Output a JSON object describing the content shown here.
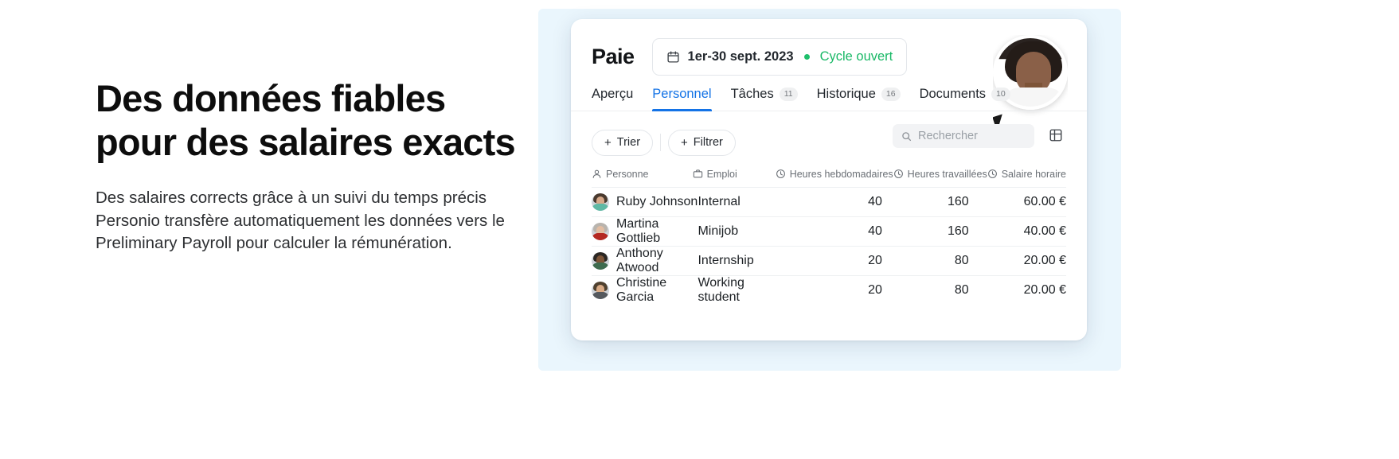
{
  "hero": {
    "headline_line1": "Des données fiables",
    "headline_line2": "pour des salaires exacts",
    "paragraph_line1": "Des salaires corrects grâce à un suivi du temps précis",
    "paragraph_line2": "Personio transfère automatiquement les données vers le",
    "paragraph_line3": "Preliminary Payroll pour calculer la rémunération."
  },
  "app": {
    "brand": "Paie",
    "date_range": "1er-30 sept. 2023",
    "cycle_status": "Cycle ouvert",
    "status_color": "#19b866",
    "accent_color": "#1473e6",
    "tabs": [
      {
        "label": "Aperçu",
        "badge": "",
        "active": false
      },
      {
        "label": "Personnel",
        "badge": "",
        "active": true
      },
      {
        "label": "Tâches",
        "badge": "11",
        "active": false
      },
      {
        "label": "Historique",
        "badge": "16",
        "active": false
      },
      {
        "label": "Documents",
        "badge": "10",
        "active": false
      }
    ],
    "toolbar": {
      "sort_label": "Trier",
      "filter_label": "Filtrer",
      "plus_glyph": "+",
      "search_placeholder": "Rechercher",
      "search_value": ""
    },
    "table": {
      "columns": [
        {
          "label": "Personne",
          "icon": "person-icon"
        },
        {
          "label": "Emploi",
          "icon": "briefcase-icon"
        },
        {
          "label": "Heures hebdomadaires",
          "icon": "clock-icon"
        },
        {
          "label": "Heures travaillées",
          "icon": "clock-icon"
        },
        {
          "label": "Salaire horaire",
          "icon": "clock-icon"
        }
      ],
      "rows": [
        {
          "name": "Ruby Johnson",
          "job": "Internal",
          "weekly_hours": "40",
          "worked_hours": "160",
          "hourly_rate": "60.00 €"
        },
        {
          "name": "Martina Gottlieb",
          "job": "Minijob",
          "weekly_hours": "40",
          "worked_hours": "160",
          "hourly_rate": "40.00 €"
        },
        {
          "name": "Anthony Atwood",
          "job": "Internship",
          "weekly_hours": "20",
          "worked_hours": "80",
          "hourly_rate": "20.00 €"
        },
        {
          "name": "Christine Garcia",
          "job": "Working student",
          "weekly_hours": "20",
          "worked_hours": "80",
          "hourly_rate": "20.00 €"
        }
      ]
    }
  }
}
